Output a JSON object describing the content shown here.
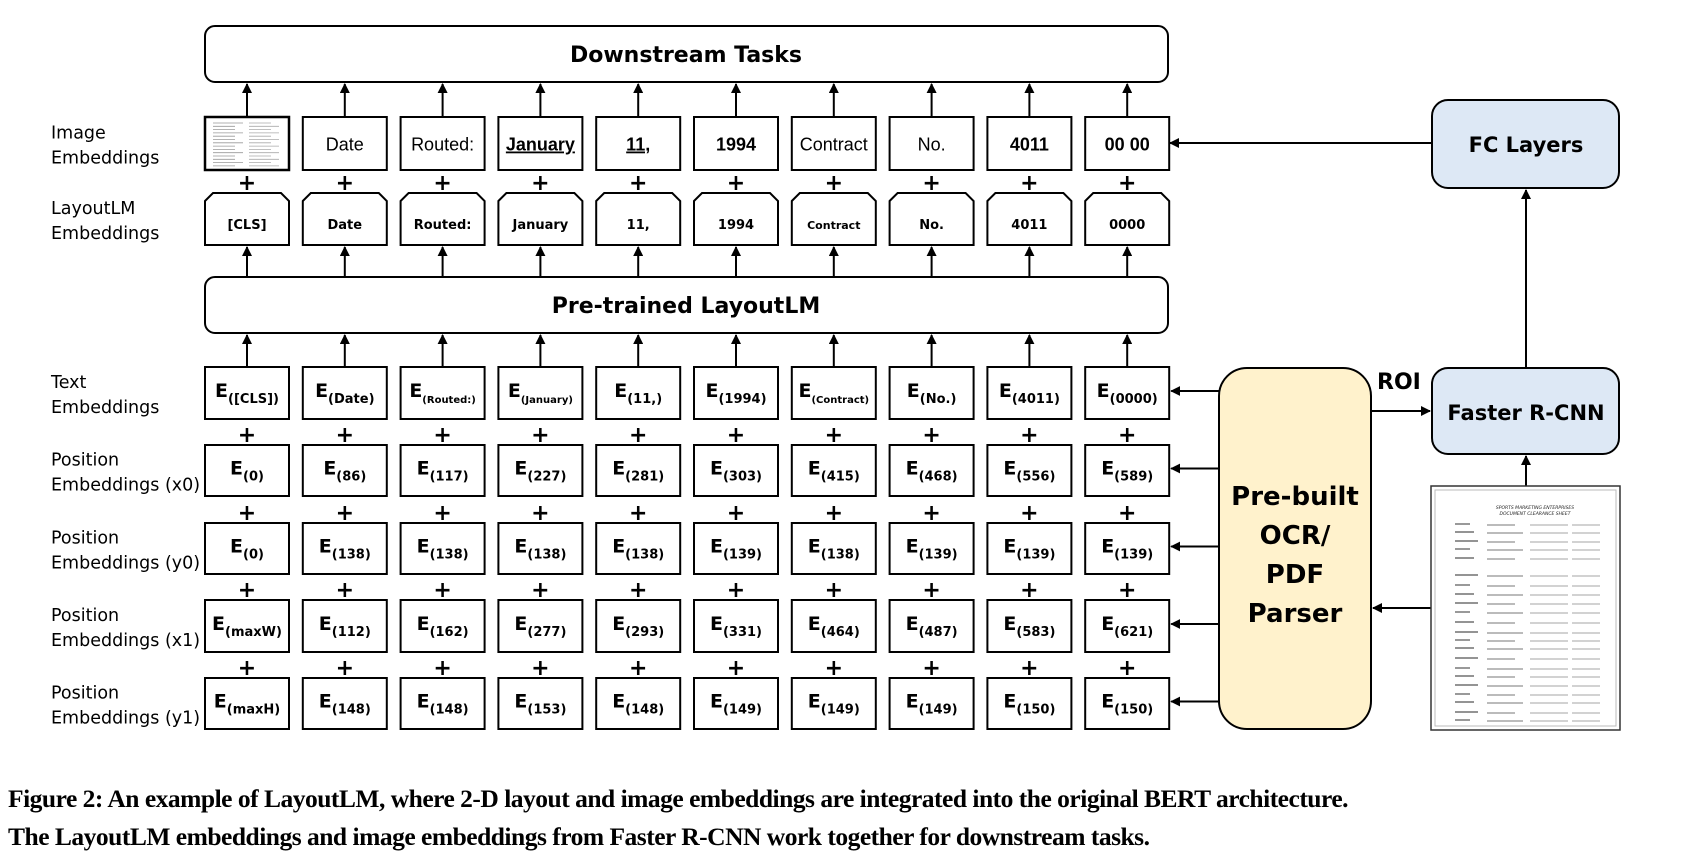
{
  "diagram": {
    "downstream_title": "Downstream Tasks",
    "pretrained_title": "Pre-trained LayoutLM",
    "fc_layers_label": "FC Layers",
    "faster_rcnn_label": "Faster R-CNN",
    "roi_label": "ROI",
    "ocr_parser_lines": [
      "Pre-built",
      "OCR/",
      "PDF",
      "Parser"
    ],
    "colors": {
      "blue_box": "#dde8f5",
      "cream_box": "#fff2cc",
      "stroke": "#000000"
    },
    "row_labels": {
      "image": [
        "Image",
        "Embeddings"
      ],
      "layoutlm": [
        "LayoutLM",
        "Embeddings"
      ],
      "text": [
        "Text",
        "Embeddings"
      ],
      "x0": [
        "Position",
        "Embeddings (x0)"
      ],
      "y0": [
        "Position",
        "Embeddings (y0)"
      ],
      "x1": [
        "Position",
        "Embeddings (x1)"
      ],
      "y1": [
        "Position",
        "Embeddings (y1)"
      ]
    },
    "plus_sign": "+",
    "embedding_prefix": "E",
    "image_tokens": [
      "[document-thumbnail]",
      "Date",
      "Routed:",
      "January",
      "11,",
      "1994",
      "Contract",
      "No.",
      "4011",
      "00 00"
    ],
    "image_tokens_underlined": [
      false,
      false,
      false,
      true,
      true,
      false,
      false,
      false,
      false,
      false
    ],
    "layoutlm_tokens": [
      "[CLS]",
      "Date",
      "Routed:",
      "January",
      "11,",
      "1994",
      "Contract",
      "No.",
      "4011",
      "0000"
    ],
    "text_embeddings": [
      "([CLS])",
      "(Date)",
      "(Routed:)",
      "(January)",
      "(11,)",
      "(1994)",
      "(Contract)",
      "(No.)",
      "(4011)",
      "(0000)"
    ],
    "x0_embeddings": [
      "(0)",
      "(86)",
      "(117)",
      "(227)",
      "(281)",
      "(303)",
      "(415)",
      "(468)",
      "(556)",
      "(589)"
    ],
    "y0_embeddings": [
      "(0)",
      "(138)",
      "(138)",
      "(138)",
      "(138)",
      "(139)",
      "(138)",
      "(139)",
      "(139)",
      "(139)"
    ],
    "x1_embeddings": [
      "(maxW)",
      "(112)",
      "(162)",
      "(277)",
      "(293)",
      "(331)",
      "(464)",
      "(487)",
      "(583)",
      "(621)"
    ],
    "y1_embeddings": [
      "(maxH)",
      "(148)",
      "(148)",
      "(153)",
      "(148)",
      "(149)",
      "(149)",
      "(149)",
      "(150)",
      "(150)"
    ],
    "document_header": [
      "SPORTS MARKETING ENTERPRISES",
      "DOCUMENT CLEARANCE SHEET"
    ]
  },
  "caption": {
    "line1": "Figure 2: An example of LayoutLM, where 2-D layout and image embeddings are integrated into the original BERT architecture.",
    "line2": "The LayoutLM embeddings and image embeddings from Faster R-CNN work together for downstream tasks."
  }
}
